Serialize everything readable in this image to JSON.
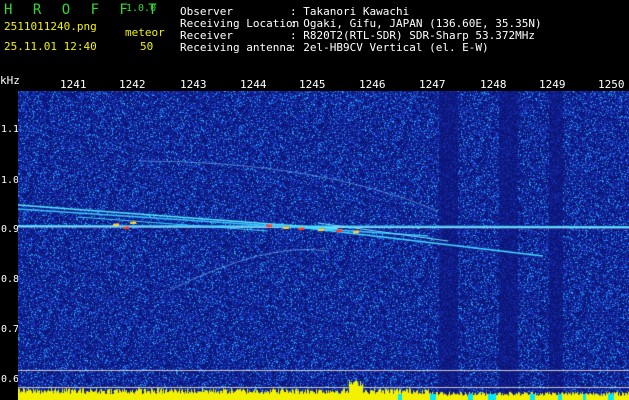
{
  "header": {
    "app_title": "H R O F F T",
    "app_version": "1.0.0",
    "filename": "2511011240.png",
    "timestamp": "25.11.01 12:40",
    "meteor_label": "meteor",
    "meteor_count": "50",
    "info": [
      {
        "label": "Observer",
        "value": ": Takanori Kawachi"
      },
      {
        "label": "Receiving Location",
        "value": ": Ogaki, Gifu, JAPAN (136.60E, 35.35N)"
      },
      {
        "label": "Receiver",
        "value": ": R820T2(RTL-SDR) SDR-Sharp 53.372MHz"
      },
      {
        "label": "Receiving antenna",
        "value": ": 2el-HB9CV Vertical (el. E-W)"
      }
    ]
  },
  "axes": {
    "x_unit": "",
    "x_ticks": [
      "1241",
      "1242",
      "1243",
      "1244",
      "1245",
      "1246",
      "1247",
      "1248",
      "1249",
      "1250"
    ],
    "y_unit": "kHz",
    "y_ticks": [
      "1.1",
      "1.0",
      "0.9",
      "0.8",
      "0.7",
      "0.6"
    ]
  },
  "colors": {
    "background": "#000000",
    "title_green": "#37d637",
    "info_yellow": "#f2f200",
    "noise_blue": "#1a2fa8",
    "signal_cyan": "#00e8ff",
    "signal_red": "#ff2a2a",
    "bottom_yellow": "#f2f200"
  }
}
